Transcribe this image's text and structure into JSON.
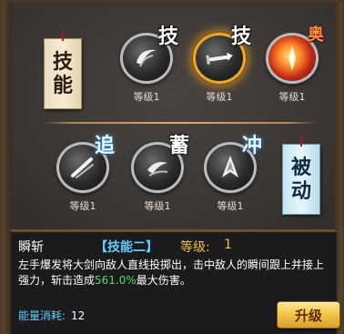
{
  "active_tag": [
    "技",
    "能"
  ],
  "passive_tag": [
    "被",
    "动"
  ],
  "skills_row1": [
    {
      "char": "技",
      "level": "等级1",
      "icon": "crescent-slash-icon",
      "char_style": "white",
      "selected": false
    },
    {
      "char": "技",
      "level": "等级1",
      "icon": "sword-thrust-icon",
      "char_style": "white",
      "selected": true
    },
    {
      "char": "奥",
      "level": "等级1",
      "icon": "fire-blade-icon",
      "char_style": "red",
      "selected": false
    }
  ],
  "skills_row2": [
    {
      "char": "追",
      "level": "等级1",
      "icon": "chase-slash-icon",
      "char_style": "blue"
    },
    {
      "char": "蓄",
      "level": "等级1",
      "icon": "charge-swirl-icon",
      "char_style": "white"
    },
    {
      "char": "冲",
      "level": "等级1",
      "icon": "dash-strike-icon",
      "char_style": "blue"
    }
  ],
  "info": {
    "name": "瞬斩",
    "tag": "【技能二】",
    "level_label": "等级:",
    "level_value": "1",
    "desc_part1": "左手爆发将大剑向敌人直线投掷出，击中敌人的瞬间跟上并接上强力，斩击造成",
    "desc_highlight": "561.0%",
    "desc_part2": "最大伤害。",
    "energy_label": "能量消耗:",
    "energy_value": "12",
    "upgrade_label": "升级"
  },
  "colors": {
    "selected_ring": "#e8a832",
    "tag_blue": "#5fd0ff",
    "level_gold": "#f0c040",
    "highlight_green": "#50e060"
  }
}
